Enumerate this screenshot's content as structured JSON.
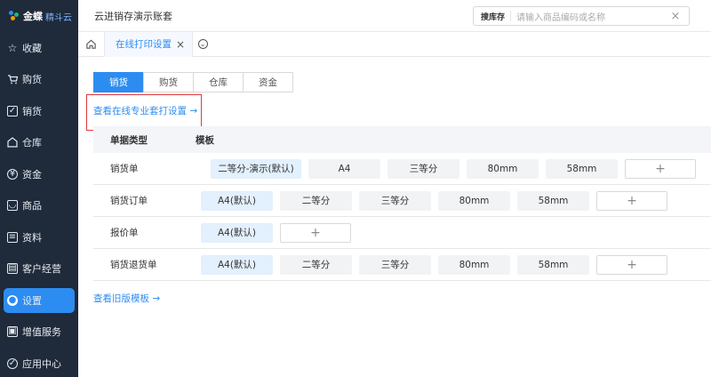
{
  "brand": {
    "name": "金蝶",
    "sub": "精斗云"
  },
  "sidebar": {
    "items": [
      {
        "label": "收藏",
        "icon": "star-icon"
      },
      {
        "label": "购货",
        "icon": "cart-icon"
      },
      {
        "label": "销货",
        "icon": "sales-icon"
      },
      {
        "label": "仓库",
        "icon": "warehouse-icon"
      },
      {
        "label": "资金",
        "icon": "yen-icon"
      },
      {
        "label": "商品",
        "icon": "product-icon"
      },
      {
        "label": "资料",
        "icon": "document-icon"
      },
      {
        "label": "客户经营",
        "icon": "customer-icon"
      },
      {
        "label": "设置",
        "icon": "gear-icon",
        "active": true
      },
      {
        "label": "增值服务",
        "icon": "service-icon"
      },
      {
        "label": "应用中心",
        "icon": "app-icon"
      }
    ]
  },
  "header": {
    "title": "云进销存演示账套",
    "search": {
      "scope": "搜库存",
      "placeholder": "请输入商品编码或名称"
    }
  },
  "tabs": {
    "active_label": "在线打印设置"
  },
  "segments": [
    "销货",
    "购货",
    "仓库",
    "资金"
  ],
  "links": {
    "pro_setting": "查看在线专业套打设置 →",
    "old_template": "查看旧版模板 →"
  },
  "table": {
    "headers": {
      "type": "单据类型",
      "template": "模板"
    },
    "rows": [
      {
        "name": "销货单",
        "templates": [
          "二等分-演示(默认)",
          "A4",
          "三等分",
          "80mm",
          "58mm"
        ]
      },
      {
        "name": "销货订单",
        "templates": [
          "A4(默认)",
          "二等分",
          "三等分",
          "80mm",
          "58mm"
        ]
      },
      {
        "name": "报价单",
        "templates": [
          "A4(默认)"
        ]
      },
      {
        "name": "销货退货单",
        "templates": [
          "A4(默认)",
          "二等分",
          "三等分",
          "80mm",
          "58mm"
        ]
      }
    ],
    "add_symbol": "+"
  },
  "colors": {
    "accent": "#2d8cf0",
    "sidebar_bg": "#1f2a3a",
    "highlight": "#e0393e"
  }
}
